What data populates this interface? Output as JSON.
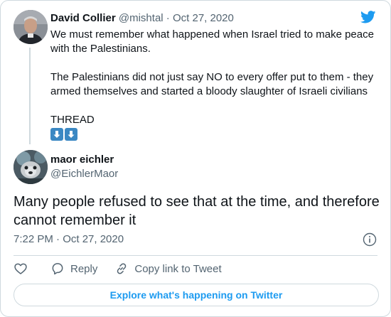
{
  "quoted_tweet": {
    "author_name": "David Collier",
    "author_handle": "@mishtal",
    "separator": "·",
    "date": "Oct 27, 2020",
    "text_line1": "We must remember what happened when Israel tried to make peace with the Palestinians.",
    "text_line2": "The Palestinians did not just say NO to every offer put to them - they armed themselves and started a bloody slaughter of Israeli civilians",
    "text_line3": "THREAD",
    "emoji": [
      "down-arrow-emoji",
      "down-arrow-emoji"
    ]
  },
  "tweet": {
    "author_name": "maor eichler",
    "author_handle": "@EichlerMaor",
    "text": "Many people refused to see that at the time, and therefore cannot remember it",
    "time_date": "7:22 PM · Oct 27, 2020"
  },
  "actions": {
    "reply_label": "Reply",
    "copy_link_label": "Copy link to Tweet"
  },
  "explore_button_label": "Explore what's happening on Twitter",
  "icons": [
    "twitter-logo-icon",
    "info-icon",
    "heart-icon",
    "reply-icon",
    "link-icon"
  ],
  "colors": {
    "brand_blue": "#1d9bf0",
    "secondary_text": "#536471",
    "border": "#cfd9de",
    "emoji_blue": "#3b88c3"
  }
}
